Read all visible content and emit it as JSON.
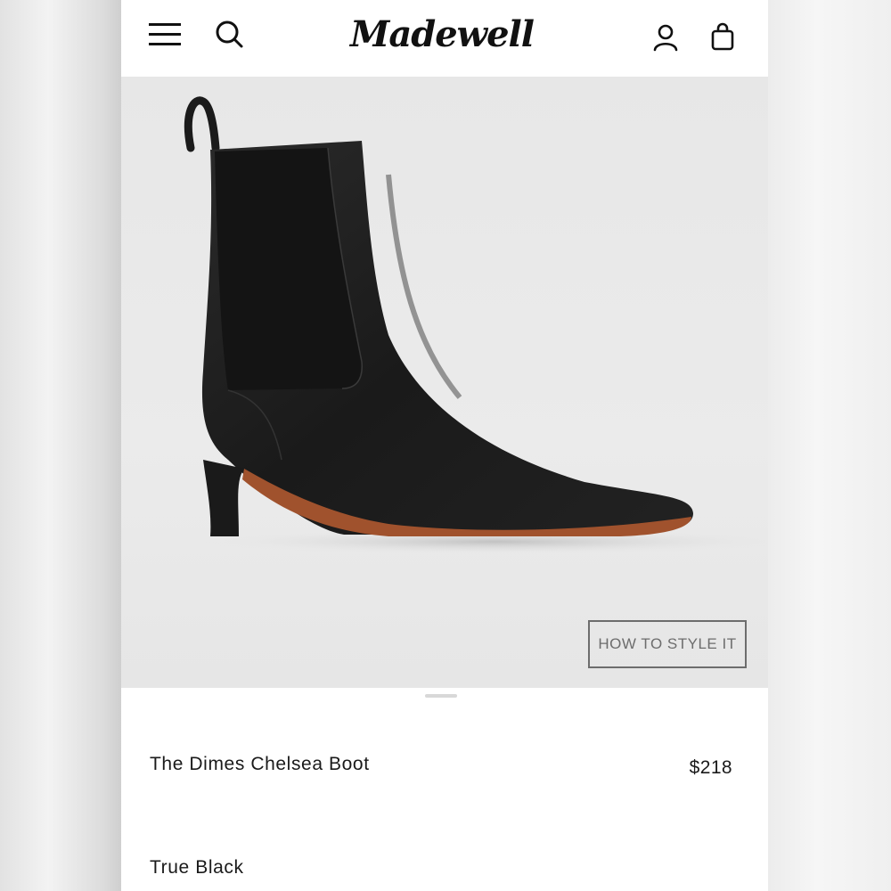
{
  "header": {
    "brand": "Madewell",
    "icons": {
      "menu": "hamburger-menu-icon",
      "search": "search-icon",
      "account": "account-icon",
      "bag": "shopping-bag-icon"
    }
  },
  "hero": {
    "image_alt": "The Dimes Chelsea Boot in True Black",
    "style_button_label": "HOW TO STYLE IT"
  },
  "product": {
    "name": "The Dimes Chelsea Boot",
    "price": "$218",
    "color": "True Black"
  },
  "colors": {
    "text": "#1a1a1a",
    "hero_background": "#e9e9e9",
    "button_border": "#6d6d6d",
    "boot_leather": "#1c1c1c",
    "sole": "#a0522d"
  }
}
